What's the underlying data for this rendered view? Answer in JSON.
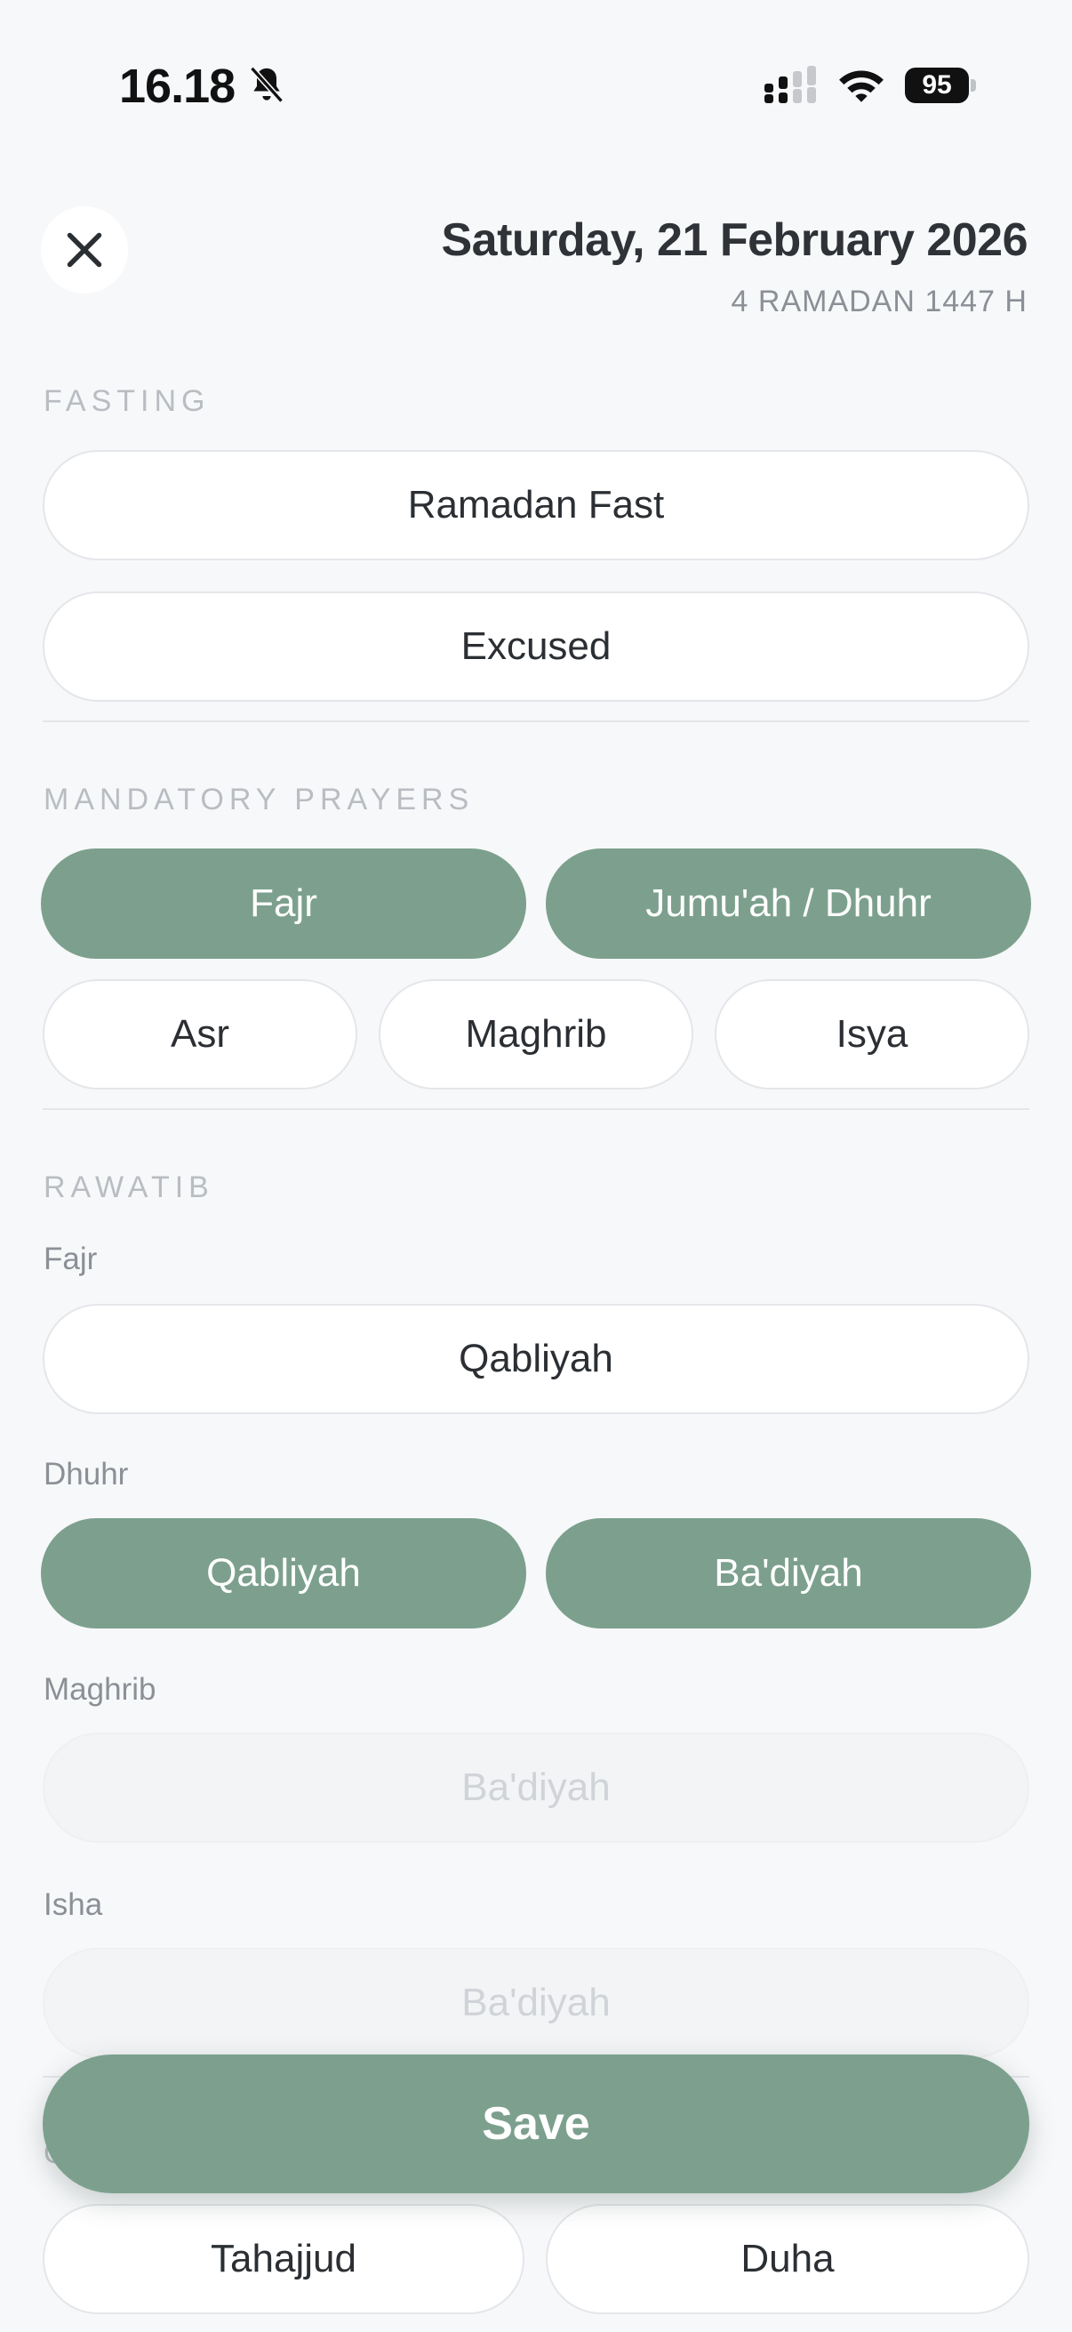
{
  "status": {
    "time": "16.18",
    "battery": "95"
  },
  "header": {
    "date": "Saturday, 21 February 2026",
    "hijri": "4 RAMADAN 1447 H"
  },
  "fasting": {
    "title": "FASTING",
    "options": [
      {
        "label": "Ramadan Fast",
        "active": false
      },
      {
        "label": "Excused",
        "active": false
      }
    ]
  },
  "mandatory": {
    "title": "MANDATORY PRAYERS",
    "options": [
      {
        "label": "Fajr",
        "active": true
      },
      {
        "label": "Jumu'ah / Dhuhr",
        "active": true
      },
      {
        "label": "Asr",
        "active": false
      },
      {
        "label": "Maghrib",
        "active": false
      },
      {
        "label": "Isya",
        "active": false
      }
    ]
  },
  "rawatib": {
    "title": "RAWATIB",
    "groups": [
      {
        "label": "Fajr",
        "options": [
          {
            "label": "Qabliyah",
            "state": "inactive"
          }
        ]
      },
      {
        "label": "Dhuhr",
        "options": [
          {
            "label": "Qabliyah",
            "state": "active"
          },
          {
            "label": "Ba'diyah",
            "state": "active"
          }
        ]
      },
      {
        "label": "Maghrib",
        "options": [
          {
            "label": "Ba'diyah",
            "state": "disabled"
          }
        ]
      },
      {
        "label": "Isha",
        "options": [
          {
            "label": "Ba'diyah",
            "state": "disabled"
          }
        ]
      }
    ]
  },
  "other": {
    "title_peek": "O",
    "options": [
      {
        "label": "Tahajjud",
        "active": false
      },
      {
        "label": "Duha",
        "active": false
      }
    ]
  },
  "save_label": "Save",
  "colors": {
    "accent": "#7ca08d",
    "background": "#f7f8fa"
  }
}
